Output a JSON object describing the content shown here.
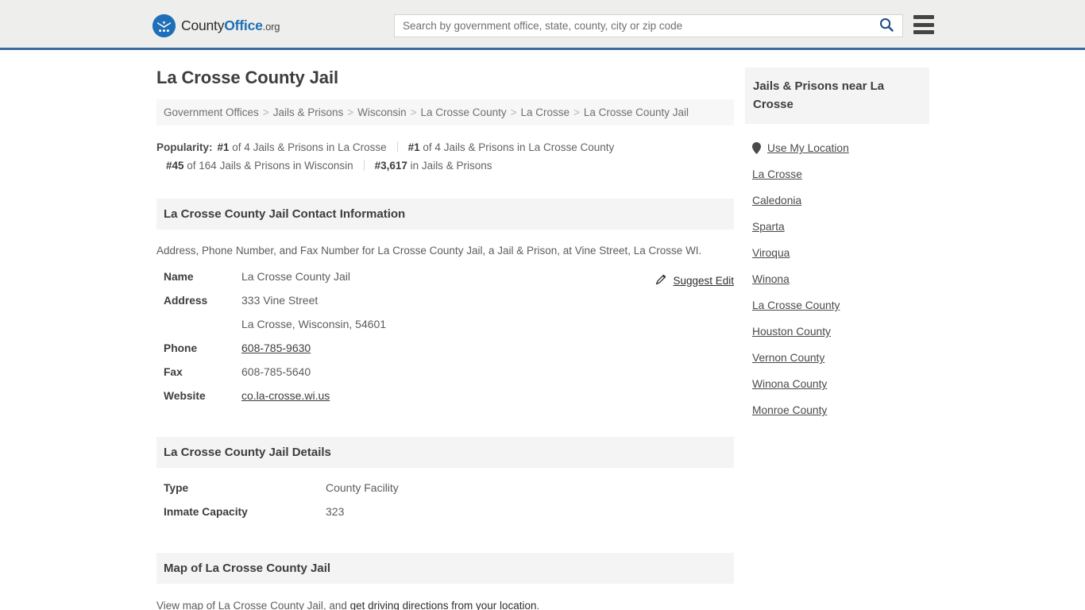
{
  "header": {
    "logo": {
      "part1": "County",
      "part2": "Office",
      "part3": ".org",
      "icon": "eagle-seal-icon"
    },
    "search": {
      "placeholder": "Search by government office, state, county, city or zip code",
      "value": "",
      "icon": "search-icon"
    },
    "menu_icon": "hamburger-menu-icon",
    "accent_color": "#3b6d9c",
    "background_color": "#eeeeec"
  },
  "main": {
    "title": "La Crosse County Jail",
    "breadcrumb": {
      "separator": ">",
      "items": [
        "Government Offices",
        "Jails & Prisons",
        "Wisconsin",
        "La Crosse County",
        "La Crosse",
        "La Crosse County Jail"
      ]
    },
    "popularity": {
      "label": "Popularity:",
      "items": [
        {
          "rank": "#1",
          "rest": " of 4 Jails & Prisons in La Crosse"
        },
        {
          "rank": "#1",
          "rest": " of 4 Jails & Prisons in La Crosse County"
        },
        {
          "rank": "#45",
          "rest": " of 164 Jails & Prisons in Wisconsin"
        },
        {
          "rank": "#3,617",
          "rest": " in Jails & Prisons"
        }
      ]
    },
    "contact": {
      "heading": "La Crosse County Jail Contact Information",
      "description": "Address, Phone Number, and Fax Number for La Crosse County Jail, a Jail & Prison, at Vine Street, La Crosse WI.",
      "suggest_edit": {
        "label": "Suggest Edit",
        "icon": "pencil-edit-icon"
      },
      "rows": [
        {
          "key": "Name",
          "value": "La Crosse County Jail",
          "link": false
        },
        {
          "key": "Address",
          "value": "333 Vine Street",
          "link": false
        },
        {
          "key": "",
          "value": "La Crosse, Wisconsin, 54601",
          "link": false
        },
        {
          "key": "Phone",
          "value": "608-785-9630",
          "link": true
        },
        {
          "key": "Fax",
          "value": "608-785-5640",
          "link": false
        },
        {
          "key": "Website",
          "value": "co.la-crosse.wi.us",
          "link": true
        }
      ]
    },
    "details": {
      "heading": "La Crosse County Jail Details",
      "rows": [
        {
          "key": "Type",
          "value": "County Facility"
        },
        {
          "key": "Inmate Capacity",
          "value": "323"
        }
      ]
    },
    "map": {
      "heading": "Map of La Crosse County Jail",
      "text_before": "View map of La Crosse County Jail, and ",
      "link_text": "get driving directions from your location",
      "text_after": "."
    }
  },
  "sidebar": {
    "heading": "Jails & Prisons near La Crosse",
    "items": [
      {
        "label": "Use My Location",
        "icon": "map-pin-icon"
      },
      {
        "label": "La Crosse",
        "icon": ""
      },
      {
        "label": "Caledonia",
        "icon": ""
      },
      {
        "label": "Sparta",
        "icon": ""
      },
      {
        "label": "Viroqua",
        "icon": ""
      },
      {
        "label": "Winona",
        "icon": ""
      },
      {
        "label": "La Crosse County",
        "icon": ""
      },
      {
        "label": "Houston County",
        "icon": ""
      },
      {
        "label": "Vernon County",
        "icon": ""
      },
      {
        "label": "Winona County",
        "icon": ""
      },
      {
        "label": "Monroe County",
        "icon": ""
      }
    ]
  }
}
